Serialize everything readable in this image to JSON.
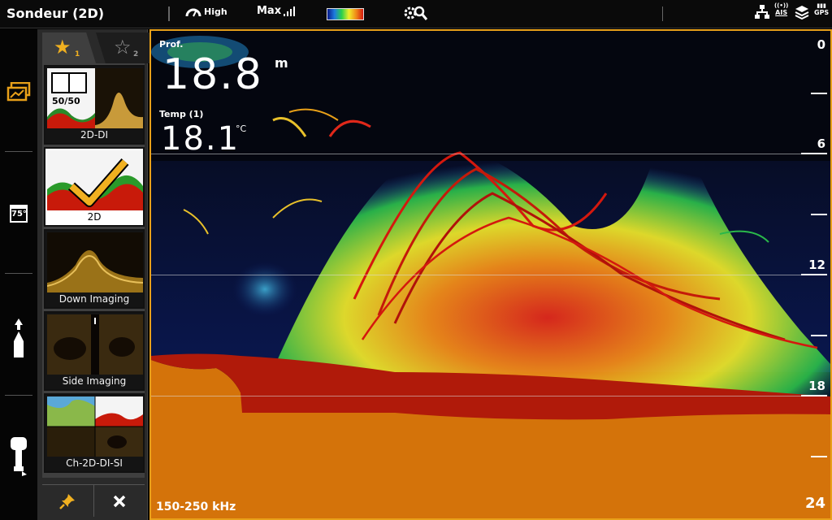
{
  "app": {
    "title": "Sondeur (2D)"
  },
  "statusbar": {
    "sensitivity_label": "High",
    "max_label": "Max",
    "palette_colors": [
      "#0a1a8a",
      "#1e7be0",
      "#2ad14a",
      "#f0ee2a",
      "#f08a18",
      "#d41a10"
    ],
    "icons": [
      "speedometer-icon",
      "signal-strength-icon",
      "color-palette-icon",
      "gear-search-icon",
      "network-icon",
      "ais-icon",
      "layers-icon",
      "gps-icon"
    ],
    "ais_label": "AIS",
    "gps_label": "GPS"
  },
  "leftrail": {
    "items": [
      {
        "name": "views-icon"
      },
      {
        "name": "temperature-display-icon",
        "value": "75°"
      },
      {
        "name": "boat-direction-icon"
      },
      {
        "name": "outboard-motor-icon"
      }
    ]
  },
  "viewpanel": {
    "tabs": [
      {
        "num": "1",
        "icon": "star-filled-icon"
      },
      {
        "num": "2",
        "icon": "star-outline-icon"
      }
    ],
    "views": [
      {
        "label": "2D-DI",
        "badge": "50/50"
      },
      {
        "label": "2D",
        "selected": true
      },
      {
        "label": "Down Imaging"
      },
      {
        "label": "Side Imaging"
      },
      {
        "label": "Ch-2D-DI-SI"
      }
    ]
  },
  "sonar": {
    "depth_label": "Prof.",
    "depth_value": "18.8",
    "depth_unit": "m",
    "temp_label": "Temp (1)",
    "temp_value": "18.1",
    "temp_unit": "°C",
    "frequency": "150-250 kHz",
    "scale": {
      "top": "0",
      "marks": [
        "6",
        "12",
        "18"
      ],
      "bottom": "24"
    },
    "colors": {
      "bottom": "#d4730a",
      "strong": "#b01a0a",
      "border": "#e8a019"
    }
  }
}
